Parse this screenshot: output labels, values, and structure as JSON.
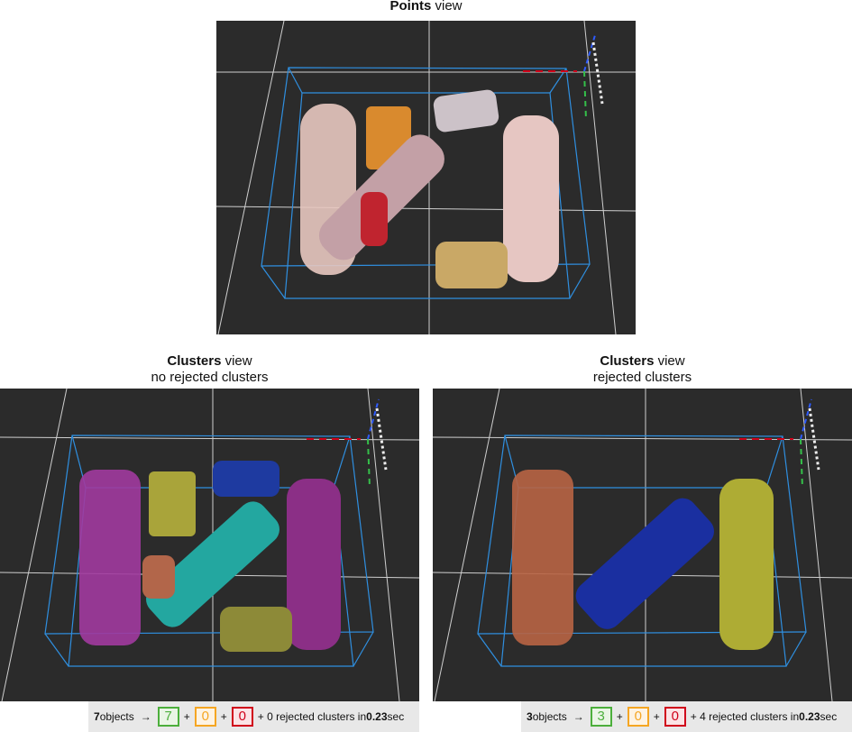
{
  "top": {
    "title_bold": "Points",
    "title_rest": " view"
  },
  "left": {
    "title_bold": "Clusters",
    "title_rest": " view",
    "subtitle": "no rejected clusters",
    "status": {
      "objects": "7",
      "objects_label": " objects",
      "arrow": "→",
      "green": "7",
      "plus1": "+",
      "orange": "0",
      "plus2": "+",
      "red": "0",
      "rejected_text": "+ 0 rejected clusters in ",
      "time": "0.23",
      "unit": " sec"
    }
  },
  "right": {
    "title_bold": "Clusters",
    "title_rest": " view",
    "subtitle": "rejected clusters",
    "status": {
      "objects": "3",
      "objects_label": " objects",
      "arrow": "→",
      "green": "3",
      "plus1": "+",
      "orange": "0",
      "plus2": "+",
      "red": "0",
      "rejected_text": "+ 4 rejected clusters in ",
      "time": "0.23",
      "unit": " sec"
    }
  },
  "colors": {
    "viewport_bg": "#2b2b2b",
    "bbox": "#2f8fe0",
    "grid": "#cfcfcf",
    "green": "#4caf3c",
    "orange": "#f5a623",
    "red": "#d0021b"
  }
}
